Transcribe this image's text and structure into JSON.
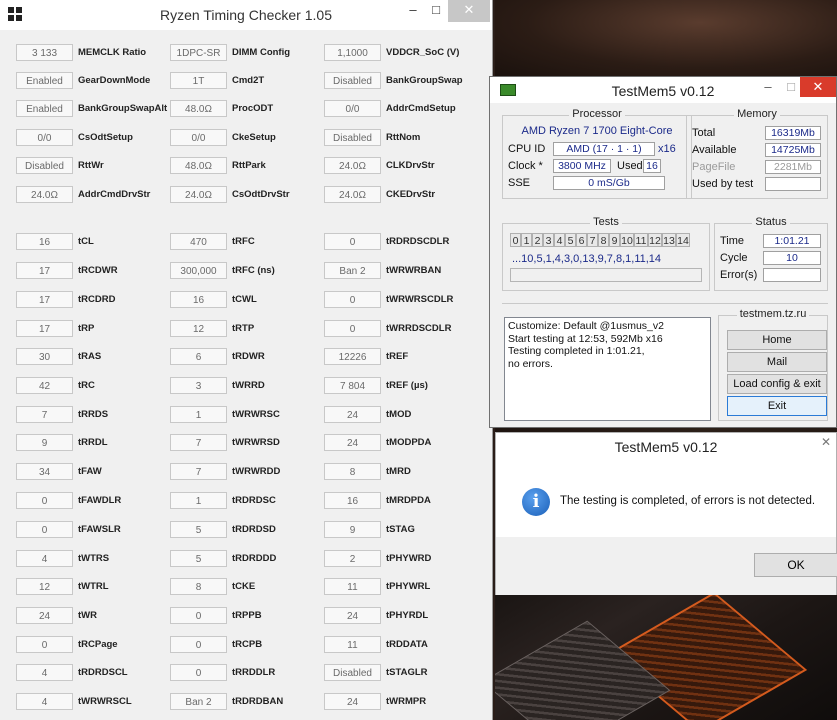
{
  "rtc": {
    "title": "Ryzen Timing Checker 1.05",
    "minimize": "–",
    "maximize": "□",
    "close": "✕",
    "rows": [
      [
        [
          "3 133",
          "MEMCLK Ratio"
        ],
        [
          "1DPC-SR",
          "DIMM Config"
        ],
        [
          "1,1000",
          "VDDCR_SoC (V)"
        ]
      ],
      [
        [
          "Enabled",
          "GearDownMode"
        ],
        [
          "1T",
          "Cmd2T"
        ],
        [
          "Disabled",
          "BankGroupSwap"
        ]
      ],
      [
        [
          "Enabled",
          "BankGroupSwapAlt"
        ],
        [
          "48.0Ω",
          "ProcODT"
        ],
        [
          "0/0",
          "AddrCmdSetup"
        ]
      ],
      [
        [
          "0/0",
          "CsOdtSetup"
        ],
        [
          "0/0",
          "CkeSetup"
        ],
        [
          "Disabled",
          "RttNom"
        ]
      ],
      [
        [
          "Disabled",
          "RttWr"
        ],
        [
          "48.0Ω",
          "RttPark"
        ],
        [
          "24.0Ω",
          "CLKDrvStr"
        ]
      ],
      [
        [
          "24.0Ω",
          "AddrCmdDrvStr"
        ],
        [
          "24.0Ω",
          "CsOdtDrvStr"
        ],
        [
          "24.0Ω",
          "CKEDrvStr"
        ]
      ],
      [
        [
          "16",
          "tCL"
        ],
        [
          "470",
          "tRFC"
        ],
        [
          "0",
          "tRDRDSCDLR"
        ]
      ],
      [
        [
          "17",
          "tRCDWR"
        ],
        [
          "300,000",
          "tRFC (ns)"
        ],
        [
          "Ban 2",
          "tWRWRBAN"
        ]
      ],
      [
        [
          "17",
          "tRCDRD"
        ],
        [
          "16",
          "tCWL"
        ],
        [
          "0",
          "tWRWRSCDLR"
        ]
      ],
      [
        [
          "17",
          "tRP"
        ],
        [
          "12",
          "tRTP"
        ],
        [
          "0",
          "tWRRDSCDLR"
        ]
      ],
      [
        [
          "30",
          "tRAS"
        ],
        [
          "6",
          "tRDWR"
        ],
        [
          "12226",
          "tREF"
        ]
      ],
      [
        [
          "42",
          "tRC"
        ],
        [
          "3",
          "tWRRD"
        ],
        [
          "7 804",
          "tREF (µs)"
        ]
      ],
      [
        [
          "7",
          "tRRDS"
        ],
        [
          "1",
          "tWRWRSC"
        ],
        [
          "24",
          "tMOD"
        ]
      ],
      [
        [
          "9",
          "tRRDL"
        ],
        [
          "7",
          "tWRWRSD"
        ],
        [
          "24",
          "tMODPDA"
        ]
      ],
      [
        [
          "34",
          "tFAW"
        ],
        [
          "7",
          "tWRWRDD"
        ],
        [
          "8",
          "tMRD"
        ]
      ],
      [
        [
          "0",
          "tFAWDLR"
        ],
        [
          "1",
          "tRDRDSC"
        ],
        [
          "16",
          "tMRDPDA"
        ]
      ],
      [
        [
          "0",
          "tFAWSLR"
        ],
        [
          "5",
          "tRDRDSD"
        ],
        [
          "9",
          "tSTAG"
        ]
      ],
      [
        [
          "4",
          "tWTRS"
        ],
        [
          "5",
          "tRDRDDD"
        ],
        [
          "2",
          "tPHYWRD"
        ]
      ],
      [
        [
          "12",
          "tWTRL"
        ],
        [
          "8",
          "tCKE"
        ],
        [
          "11",
          "tPHYWRL"
        ]
      ],
      [
        [
          "24",
          "tWR"
        ],
        [
          "0",
          "tRPPB"
        ],
        [
          "24",
          "tPHYRDL"
        ]
      ],
      [
        [
          "0",
          "tRCPage"
        ],
        [
          "0",
          "tRCPB"
        ],
        [
          "11",
          "tRDDATA"
        ]
      ],
      [
        [
          "4",
          "tRDRDSCL"
        ],
        [
          "0",
          "tRRDDLR"
        ],
        [
          "Disabled",
          "tSTAGLR"
        ]
      ],
      [
        [
          "4",
          "tWRWRSCL"
        ],
        [
          "Ban 2",
          "tRDRDBAN"
        ],
        [
          "24",
          "tWRMPR"
        ]
      ]
    ]
  },
  "tm": {
    "title": "TestMem5 v0.12",
    "minimize": "–",
    "maximize": "□",
    "close": "✕",
    "processor": {
      "title": "Processor",
      "name": "AMD Ryzen 7 1700 Eight-Core",
      "cpuid_label": "CPU ID",
      "cpuid": "AMD  (17 · 1 · 1)",
      "threads": "x16",
      "clock_label": "Clock *",
      "clock": "3800 MHz",
      "used_label": "Used",
      "used": "16",
      "sse_label": "SSE",
      "sse": "0 mS/Gb"
    },
    "memory": {
      "title": "Memory",
      "total_label": "Total",
      "total": "16319Mb",
      "available_label": "Available",
      "available": "14725Mb",
      "pagefile_label": "PageFile",
      "pagefile": "2281Mb",
      "usedby_label": "Used by test",
      "usedby": ""
    },
    "tests": {
      "title": "Tests",
      "numbers": [
        "0",
        "1",
        "2",
        "3",
        "4",
        "5",
        "6",
        "7",
        "8",
        "9",
        "10",
        "11",
        "12",
        "13",
        "14"
      ],
      "sequence": "...10,5,1,4,3,0,13,9,7,8,1,11,14"
    },
    "status": {
      "title": "Status",
      "time_label": "Time",
      "time": "1:01.21",
      "cycle_label": "Cycle",
      "cycle": "10",
      "errors_label": "Error(s)",
      "errors": ""
    },
    "log": [
      "Customize: Default @1usmus_v2",
      "Start testing at 12:53, 592Mb x16",
      "Testing completed in 1:01.21,",
      "no errors."
    ],
    "site": {
      "title": "testmem.tz.ru",
      "home": "Home",
      "mail": "Mail",
      "load": "Load config & exit",
      "exit": "Exit"
    }
  },
  "dialog": {
    "title": "TestMem5 v0.12",
    "close": "✕",
    "icon": "i",
    "message": "The testing is completed, of errors is not detected.",
    "ok": "OK"
  }
}
